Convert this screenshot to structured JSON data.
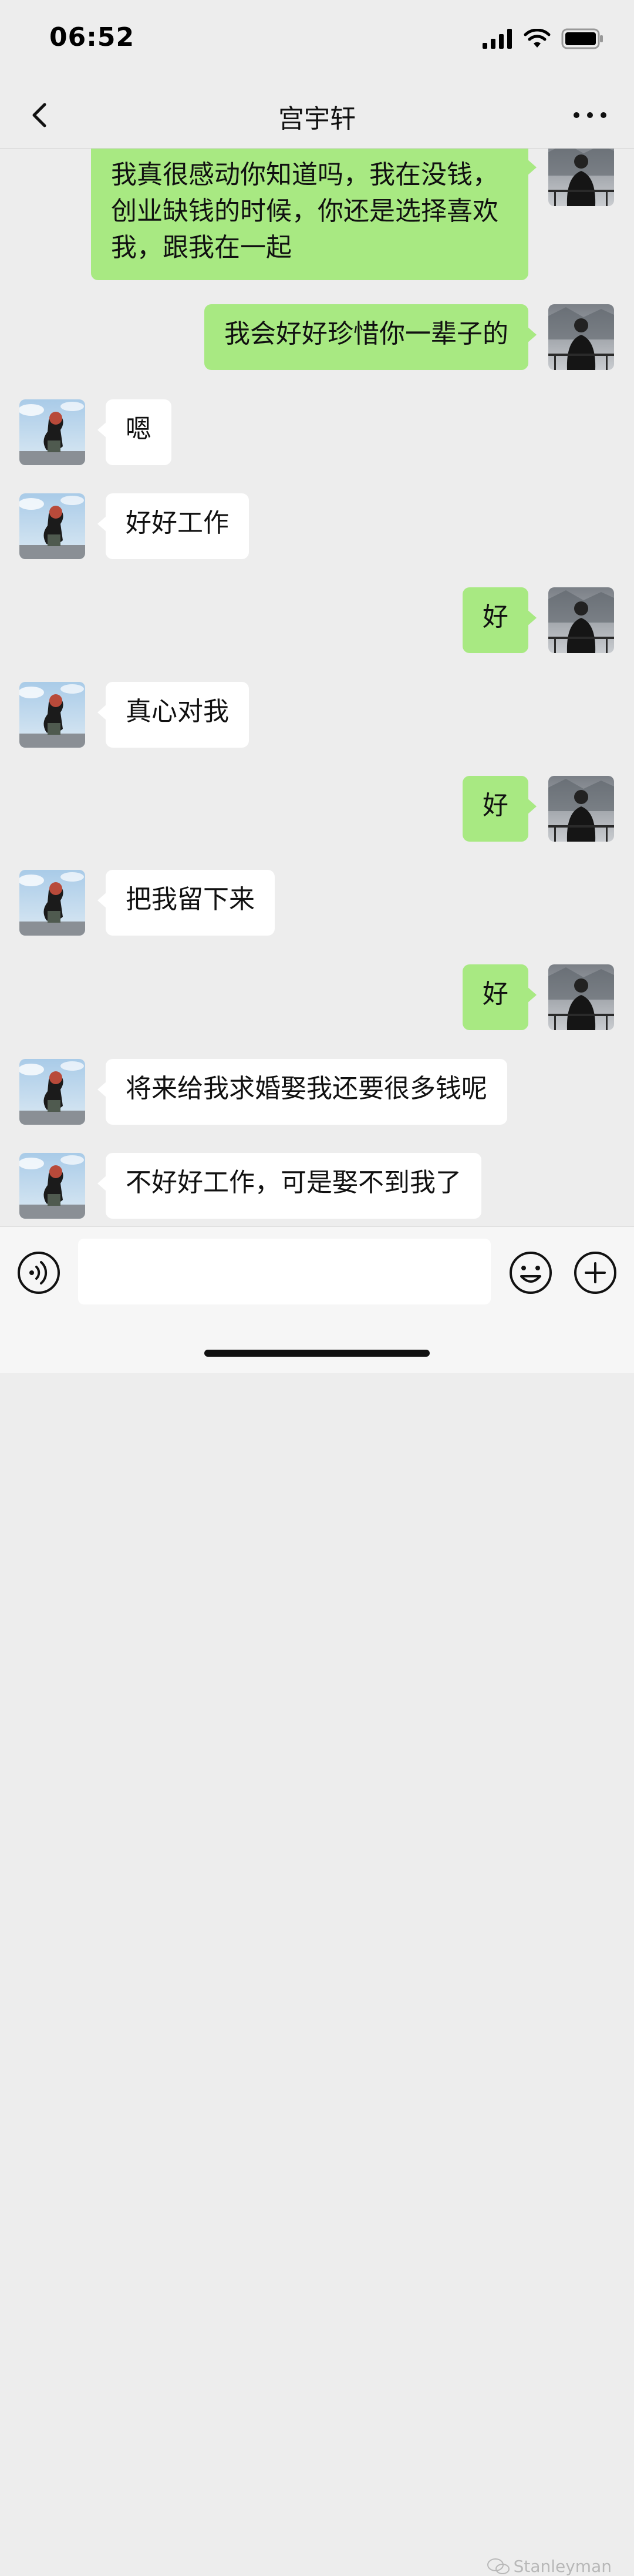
{
  "status": {
    "time": "06:52"
  },
  "header": {
    "title": "宫宇轩"
  },
  "messages": [
    {
      "from": "self",
      "text": "我真很感动你知道吗，我在没钱，创业缺钱的时候，你还是选择喜欢我，跟我在一起"
    },
    {
      "from": "self",
      "text": "我会好好珍惜你一辈子的"
    },
    {
      "from": "other",
      "text": "嗯"
    },
    {
      "from": "other",
      "text": "好好工作"
    },
    {
      "from": "self",
      "text": "好"
    },
    {
      "from": "other",
      "text": "真心对我"
    },
    {
      "from": "self",
      "text": "好"
    },
    {
      "from": "other",
      "text": "把我留下来"
    },
    {
      "from": "self",
      "text": "好"
    },
    {
      "from": "other",
      "text": "将来给我求婚娶我还要很多钱呢"
    },
    {
      "from": "other",
      "text": "不好好工作，可是娶不到我了"
    }
  ],
  "input": {
    "value": ""
  },
  "watermark": {
    "text": "Stanleyman"
  },
  "colors": {
    "self_bubble": "#a8e982",
    "other_bubble": "#ffffff",
    "background": "#ededed"
  },
  "icons": {
    "back": "chevron-left-icon",
    "more": "more-dots-icon",
    "voice": "voice-icon",
    "emoji": "emoji-icon",
    "plus": "plus-icon"
  }
}
